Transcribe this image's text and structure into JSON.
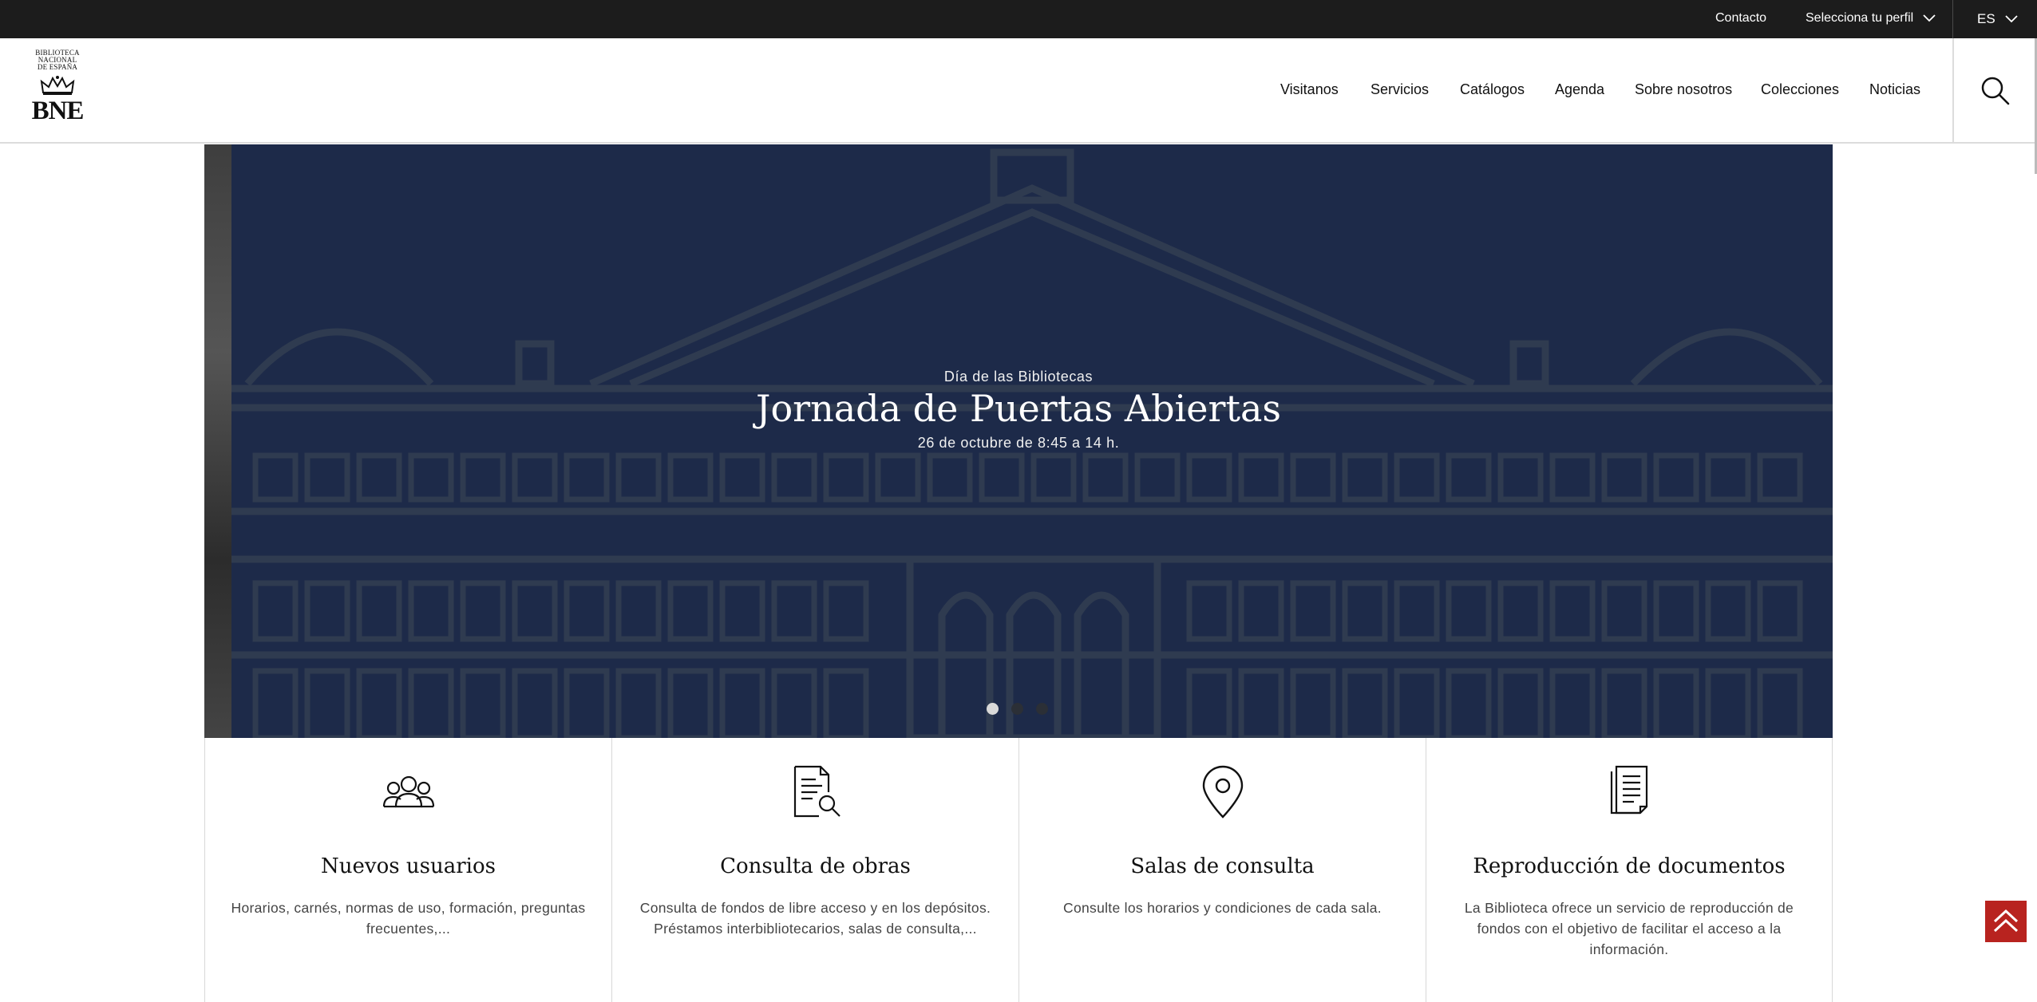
{
  "topbar": {
    "contact_label": "Contacto",
    "profile_label": "Selecciona tu perfil",
    "profile_icon": "chevron-down-icon",
    "lang_label": "ES",
    "lang_icon": "chevron-down-icon"
  },
  "header": {
    "logo": {
      "line1": "BIBLIOTECA",
      "line2": "NACIONAL",
      "line3": "DE ESPAÑA",
      "short": "BNE",
      "icon": "crown-icon"
    },
    "nav": [
      "Visitanos",
      "Servicios",
      "Catálogos",
      "Agenda",
      "Sobre nosotros",
      "Colecciones",
      "Noticias"
    ],
    "search_icon": "search-icon"
  },
  "hero": {
    "eyebrow": "Día de las Bibliotecas",
    "title": "Jornada de Puertas Abiertas",
    "subtitle": "26 de octubre de 8:45 a 14 h.",
    "slides_total": 3,
    "active_slide": 1,
    "background_color": "#1d2a49",
    "illustration_color": "#2e3a52"
  },
  "cards": [
    {
      "icon": "users-icon",
      "title": "Nuevos usuarios",
      "text": "Horarios, carnés, normas de uso, formación, preguntas frecuentes,..."
    },
    {
      "icon": "document-search-icon",
      "title": "Consulta de obras",
      "text": "Consulta de fondos de libre acceso y en los depósitos. Préstamos interbibliotecarios, salas de consulta,..."
    },
    {
      "icon": "location-pin-icon",
      "title": "Salas de consulta",
      "text": "Consulte los horarios y condiciones de cada sala."
    },
    {
      "icon": "copy-documents-icon",
      "title": "Reproducción de documentos",
      "text": "La Biblioteca ofrece un servicio de reproducción de fondos con el objetivo de facilitar el acceso a la información."
    }
  ],
  "back_to_top": {
    "icon": "double-chevron-up-icon",
    "color": "#b8231f"
  }
}
